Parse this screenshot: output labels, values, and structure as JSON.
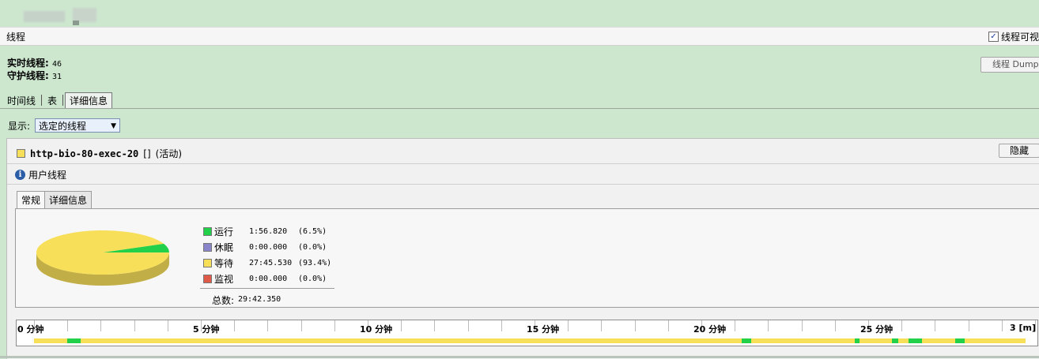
{
  "threads_section": {
    "title": "线程",
    "visible_label": "线程可视"
  },
  "stats": {
    "live_label": "实时线程",
    "live_value": "46",
    "daemon_label": "守护线程",
    "daemon_value": "31"
  },
  "dump_button": "线程 Dump",
  "tabs": [
    {
      "label": "时间线"
    },
    {
      "label": "表"
    },
    {
      "label": "详细信息"
    }
  ],
  "show": {
    "label": "显示:",
    "selected": "选定的线程"
  },
  "thread": {
    "name": "http-bio-80-exec-20",
    "bracket": "[]",
    "status": "(活动)",
    "color": "#f7df5a",
    "hide_label": "隐藏",
    "type": "用户线程"
  },
  "detail_tabs": [
    {
      "label": "常规"
    },
    {
      "label": "详细信息"
    }
  ],
  "chart_data": {
    "type": "pie",
    "slices": [
      {
        "label": "运行",
        "time": "1:56.820",
        "percent": 6.5,
        "percent_text": "(6.5%)",
        "color": "#22d04a"
      },
      {
        "label": "休眠",
        "time": "0:00.000",
        "percent": 0.0,
        "percent_text": "(0.0%)",
        "color": "#8a85c8"
      },
      {
        "label": "等待",
        "time": "27:45.530",
        "percent": 93.4,
        "percent_text": "(93.4%)",
        "color": "#f7df5a"
      },
      {
        "label": "监视",
        "time": "0:00.000",
        "percent": 0.0,
        "percent_text": "(0.0%)",
        "color": "#e05a4a"
      }
    ],
    "total_label": "总数:",
    "total_value": "29:42.350"
  },
  "timeline": {
    "labels": [
      "0 分钟",
      "5 分钟",
      "10 分钟",
      "15 分钟",
      "20 分钟",
      "25 分钟",
      "3 [m]"
    ],
    "running_segments_min": [
      [
        1.0,
        1.4
      ],
      [
        21.2,
        21.5
      ],
      [
        24.6,
        24.75
      ],
      [
        25.7,
        25.9
      ],
      [
        26.2,
        26.6
      ],
      [
        27.6,
        27.9
      ]
    ]
  }
}
